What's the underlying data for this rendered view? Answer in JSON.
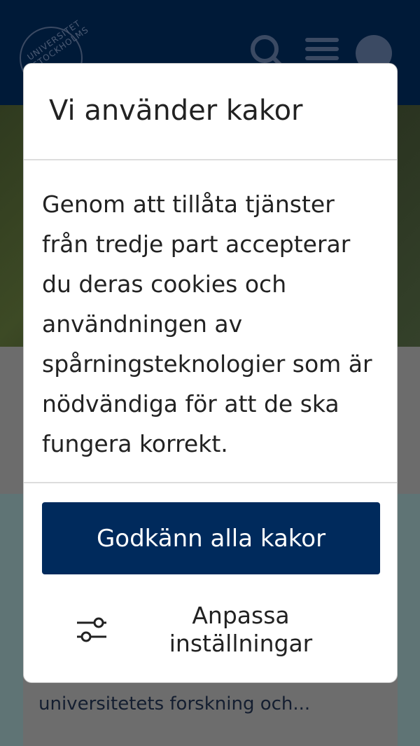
{
  "header": {
    "logo_text": "UNIVERSITET STOCKHOLMS"
  },
  "background_card": {
    "snippet": "universitetets forskning och..."
  },
  "cookie_modal": {
    "title": "Vi använder kakor",
    "body": "Genom att tillåta tjänster från tredje part accepterar du deras cookies och användningen av spårningsteknologier som är nödvändiga för att de ska fungera korrekt.",
    "accept_label": "Godkänn alla kakor",
    "customize_label_line1": "Anpassa",
    "customize_label_line2": "inställningar"
  },
  "colors": {
    "header_bg": "#001a38",
    "accept_button_bg": "#002a5c",
    "overlay": "#6b6b6b"
  },
  "icons": {
    "search": "search-icon",
    "menu": "menu-icon",
    "language": "globe-icon",
    "settings": "sliders-icon"
  }
}
